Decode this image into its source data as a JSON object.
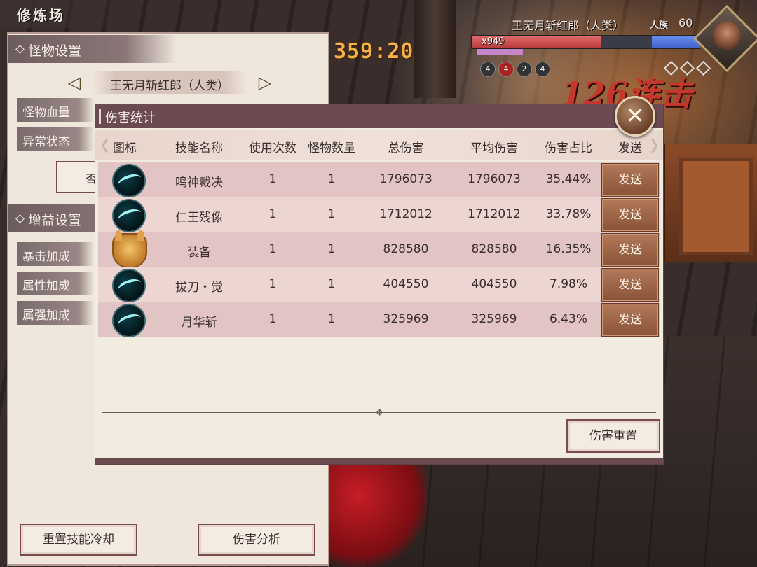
{
  "hud": {
    "timer": "359:20",
    "combo_text": "126连击",
    "boss": {
      "name": "王无月斩红郎（人类）",
      "race": "人族",
      "level": "60",
      "hp_multiplier": "x949",
      "hp_fill_percent": 57,
      "buffs": [
        "4",
        "4",
        "2",
        "4"
      ]
    }
  },
  "left_panel": {
    "title": "修炼场",
    "monster_section": "怪物设置",
    "monster_name": "王无月斩红郎（人类）",
    "rows": [
      "怪物血量",
      "异常状态"
    ],
    "ghost_button_char": "否",
    "buff_section": "增益设置",
    "buff_rows": [
      "暴击加成",
      "属性加成",
      "属强加成"
    ],
    "reset_cooldown_button": "重置技能冷却",
    "damage_analysis_button": "伤害分析"
  },
  "dialog": {
    "title": "伤害统计",
    "headers": [
      "图标",
      "技能名称",
      "使用次数",
      "怪物数量",
      "总伤害",
      "平均伤害",
      "伤害占比",
      "发送"
    ],
    "rows": [
      {
        "icon": "blade-skill-icon",
        "name": "鸣神裁决",
        "uses": "1",
        "monsters": "1",
        "total": "1796073",
        "avg": "1796073",
        "ratio": "35.44%",
        "send": "发送"
      },
      {
        "icon": "blade-skill-icon",
        "name": "仁王残像",
        "uses": "1",
        "monsters": "1",
        "total": "1712012",
        "avg": "1712012",
        "ratio": "33.78%",
        "send": "发送"
      },
      {
        "icon": "samurai-helmet-icon",
        "name": "装备",
        "uses": "1",
        "monsters": "1",
        "total": "828580",
        "avg": "828580",
        "ratio": "16.35%",
        "send": "发送"
      },
      {
        "icon": "blade-skill-icon",
        "name": "拔刀・觉",
        "uses": "1",
        "monsters": "1",
        "total": "404550",
        "avg": "404550",
        "ratio": "7.98%",
        "send": "发送"
      },
      {
        "icon": "blade-skill-icon",
        "name": "月华斩",
        "uses": "1",
        "monsters": "1",
        "total": "325969",
        "avg": "325969",
        "ratio": "6.43%",
        "send": "发送"
      }
    ],
    "reset_button": "伤害重置",
    "close_glyph": "✕"
  },
  "colors": {
    "dialog_title_bg": "#6c4a52",
    "row_odd": "#e2c4c4",
    "row_even": "#edd6d2",
    "send_button": "#9a6448",
    "timer": "#f1b24a",
    "combo": "#c5372a"
  }
}
